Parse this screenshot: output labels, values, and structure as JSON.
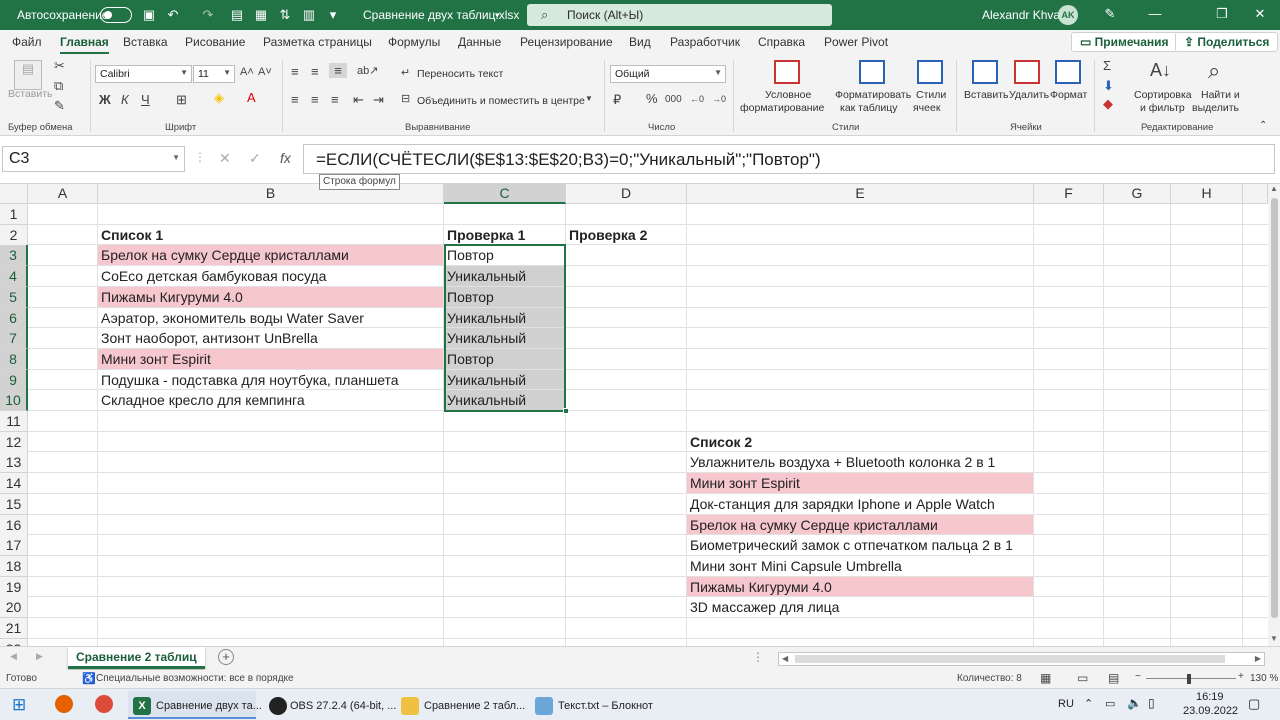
{
  "titlebar": {
    "autosave_label": "Автосохранение",
    "filename": "Сравнение двух таблиц.xlsx",
    "search_placeholder": "Поиск (Alt+Ы)",
    "user_name": "Alexandr Khvan",
    "user_initials": "AK"
  },
  "menu": {
    "tabs": [
      "Файл",
      "Главная",
      "Вставка",
      "Рисование",
      "Разметка страницы",
      "Формулы",
      "Данные",
      "Рецензирование",
      "Вид",
      "Разработчик",
      "Справка",
      "Power Pivot"
    ],
    "comments_button": "Примечания",
    "share_button": "Поделиться"
  },
  "ribbon": {
    "clipboard": {
      "paste": "Вставить",
      "group": "Буфер обмена"
    },
    "font": {
      "name": "Calibri",
      "size": "11",
      "group": "Шрифт",
      "bold": "Ж",
      "italic": "К",
      "underline": "Ч"
    },
    "alignment": {
      "wrap": "Переносить текст",
      "merge": "Объединить и поместить в центре",
      "group": "Выравнивание"
    },
    "number": {
      "format": "Общий",
      "percent": "%",
      "thousands": "000",
      "group": "Число"
    },
    "styles": {
      "conditional_1": "Условное",
      "conditional_2": "форматирование",
      "table_1": "Форматировать",
      "table_2": "как таблицу",
      "cell_1": "Стили",
      "cell_2": "ячеек",
      "group": "Стили"
    },
    "cells": {
      "insert": "Вставить",
      "delete": "Удалить",
      "format": "Формат",
      "group": "Ячейки"
    },
    "editing": {
      "sort_1": "Сортировка",
      "sort_2": "и фильтр",
      "find_1": "Найти и",
      "find_2": "выделить",
      "group": "Редактирование"
    }
  },
  "formula_bar": {
    "name_box": "C3",
    "formula": "=ЕСЛИ(СЧЁТЕСЛИ($E$13:$E$20;B3)=0;\"Уникальный\";\"Повтор\")",
    "tooltip": "Строка формул"
  },
  "grid": {
    "columns": [
      "A",
      "B",
      "C",
      "D",
      "E",
      "F",
      "G",
      "H"
    ],
    "rows": [
      "1",
      "2",
      "3",
      "4",
      "5",
      "6",
      "7",
      "8",
      "9",
      "10",
      "11",
      "12",
      "13",
      "14",
      "15",
      "16",
      "17",
      "18",
      "19",
      "20",
      "21",
      "22"
    ],
    "list1_header": "Список 1",
    "check1_header": "Проверка 1",
    "check2_header": "Проверка 2",
    "list1": [
      {
        "name": "Брелок на сумку Сердце кристаллами",
        "check": "Повтор",
        "dup": true
      },
      {
        "name": "СоЕсо детская бамбуковая посуда",
        "check": "Уникальный",
        "dup": false
      },
      {
        "name": "Пижамы Кигуруми 4.0",
        "check": "Повтор",
        "dup": true
      },
      {
        "name": "Аэратор, экономитель воды Water Saver",
        "check": "Уникальный",
        "dup": false
      },
      {
        "name": "Зонт наоборот, антизонт UnBrella",
        "check": "Уникальный",
        "dup": false
      },
      {
        "name": "Мини зонт Espirit",
        "check": "Повтор",
        "dup": true
      },
      {
        "name": "Подушка - подставка для ноутбука, планшета",
        "check": "Уникальный",
        "dup": false
      },
      {
        "name": "Складное кресло для кемпинга",
        "check": "Уникальный",
        "dup": false
      }
    ],
    "list2_header": "Список 2",
    "list2": [
      {
        "name": "Увлажнитель воздуха + Bluetooth колонка 2 в 1",
        "dup": false
      },
      {
        "name": "Мини зонт Espirit",
        "dup": true
      },
      {
        "name": "Док-станция для зарядки Iphone и Apple Watch",
        "dup": false
      },
      {
        "name": "Брелок на сумку Сердце кристаллами",
        "dup": true
      },
      {
        "name": "Биометрический замок с отпечатком пальца 2 в 1",
        "dup": false
      },
      {
        "name": "Мини зонт Mini Capsule Umbrella",
        "dup": false
      },
      {
        "name": "Пижамы Кигуруми 4.0",
        "dup": true
      },
      {
        "name": "3D массажер для лица",
        "dup": false
      }
    ]
  },
  "sheets": {
    "active": "Сравнение 2 таблиц"
  },
  "status": {
    "ready": "Готово",
    "accessibility": "Специальные возможности: все в порядке",
    "count": "Количество: 8",
    "zoom": "130 %"
  },
  "taskbar": {
    "items": [
      "Сравнение двух та...",
      "OBS 27.2.4 (64-bit, ...",
      "Сравнение 2 табл...",
      "Текст.txt – Блокнот"
    ],
    "lang": "RU",
    "time": "16:19",
    "date": "23.09.2022"
  },
  "colors": {
    "accent": "#217346",
    "dup_fill": "#f7c7ce",
    "selection": "#d0d0d0"
  }
}
